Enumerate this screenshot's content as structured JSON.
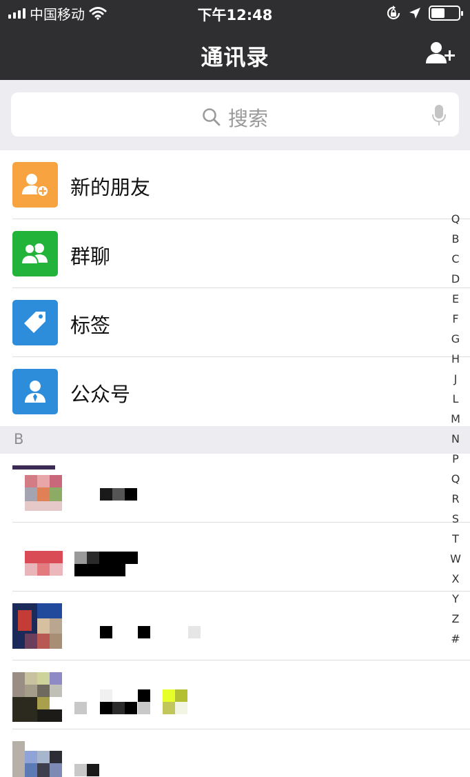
{
  "status_bar": {
    "carrier": "中国移动",
    "time": "下午12:48",
    "signal_bars": 4,
    "battery_level": 0.5
  },
  "nav_bar": {
    "title": "通讯录",
    "add_icon": "add-contact-icon"
  },
  "search": {
    "placeholder": "搜索",
    "search_icon": "search-icon",
    "voice_icon": "microphone-icon"
  },
  "menu": [
    {
      "label": "新的朋友",
      "icon": "new-friend-icon",
      "color": "#f7a440"
    },
    {
      "label": "群聊",
      "icon": "group-chat-icon",
      "color": "#22b33a"
    },
    {
      "label": "标签",
      "icon": "tag-icon",
      "color": "#2d8ddb"
    },
    {
      "label": "公众号",
      "icon": "official-account-icon",
      "color": "#2d8ddb"
    }
  ],
  "section_header": "B",
  "contacts": [
    {
      "name": "",
      "avatar_colors": [
        "#d47c86",
        "#e9a6a9",
        "#c8687a",
        "#a4a3b2",
        "#e08057",
        "#8eab66"
      ]
    },
    {
      "name": "",
      "avatar_colors": [
        "#d94c56",
        "#e27a7f",
        "#ecb7bb",
        "#f2cfd0"
      ]
    },
    {
      "name": "",
      "avatar_colors": [
        "#1c2a59",
        "#c33c35",
        "#224a9c",
        "#d6c09f",
        "#b85852",
        "#a88e75"
      ]
    },
    {
      "name": "",
      "avatar_colors": [
        "#c9c2a1",
        "#8d8ac5",
        "#cdd39a",
        "#a49d8a",
        "#2c291f",
        "#a9a04e"
      ]
    },
    {
      "name": "",
      "avatar_colors": [
        "#8fa3d6",
        "#a8b6cd",
        "#5c7ab4",
        "#7d8bb4"
      ]
    }
  ],
  "index_letters": [
    "Q",
    "B",
    "C",
    "D",
    "E",
    "F",
    "G",
    "H",
    "J",
    "L",
    "M",
    "N",
    "P",
    "Q",
    "R",
    "S",
    "T",
    "W",
    "X",
    "Y",
    "Z",
    "#"
  ]
}
